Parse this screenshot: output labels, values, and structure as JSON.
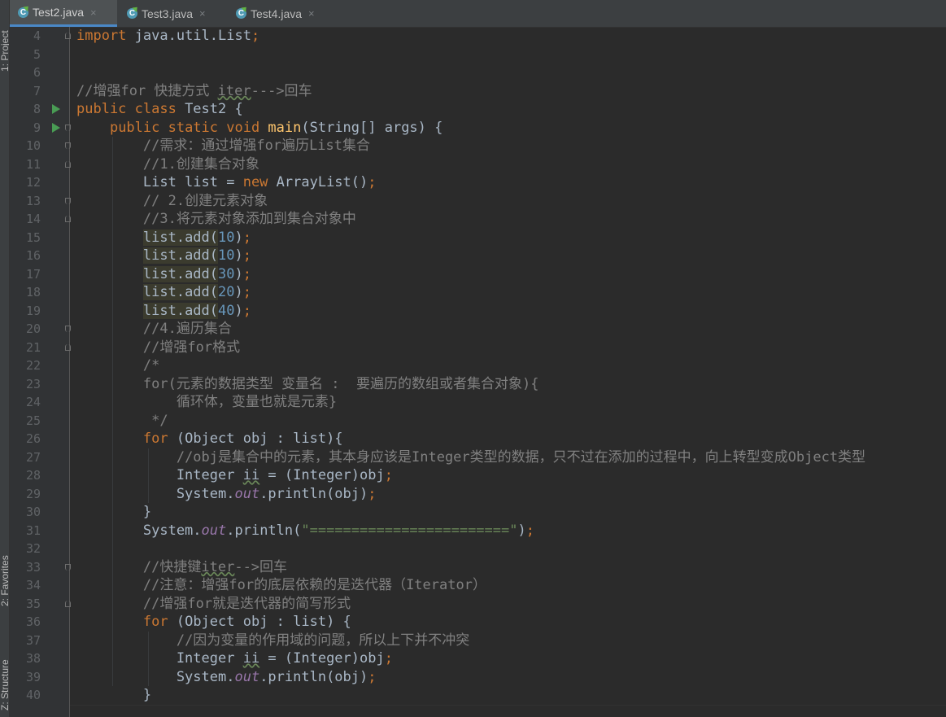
{
  "editor": {
    "tabs": [
      {
        "label": "Test2.java",
        "active": true
      },
      {
        "label": "Test3.java",
        "active": false
      },
      {
        "label": "Test4.java",
        "active": false
      }
    ],
    "tab_icon_letter": "C",
    "close_glyph": "×",
    "tool_windows": {
      "project": "1: Project",
      "favorites": "2: Favorites",
      "structure": "Z: Structure"
    },
    "lines": [
      {
        "n": "4",
        "fold": "close",
        "code": [
          {
            "t": "import",
            "c": "kw"
          },
          {
            "t": " java.util.List"
          },
          {
            "t": ";",
            "c": "kw"
          }
        ]
      },
      {
        "n": "5",
        "code": []
      },
      {
        "n": "6",
        "code": []
      },
      {
        "n": "7",
        "code": [
          {
            "t": "//增强for 快捷方式 ",
            "c": "cm"
          },
          {
            "t": "iter",
            "c": "cm warn"
          },
          {
            "t": "--->回车",
            "c": "cm"
          }
        ]
      },
      {
        "n": "8",
        "run": true,
        "code": [
          {
            "t": "public class ",
            "c": "kw"
          },
          {
            "t": "Test2 {"
          }
        ]
      },
      {
        "n": "9",
        "run": true,
        "fold": "open",
        "code": [
          {
            "t": "    "
          },
          {
            "t": "public static void ",
            "c": "kw"
          },
          {
            "t": "main",
            "c": "fn"
          },
          {
            "t": "(String[] args) {"
          }
        ]
      },
      {
        "n": "10",
        "fold": "open",
        "code": [
          {
            "t": "        "
          },
          {
            "t": "//需求：通过增强for遍历List集合",
            "c": "cm"
          }
        ]
      },
      {
        "n": "11",
        "fold": "close",
        "code": [
          {
            "t": "        "
          },
          {
            "t": "//1.创建集合对象",
            "c": "cm"
          }
        ]
      },
      {
        "n": "12",
        "code": [
          {
            "t": "        List list = "
          },
          {
            "t": "new ",
            "c": "kw"
          },
          {
            "t": "ArrayList()"
          },
          {
            "t": ";",
            "c": "kw"
          }
        ]
      },
      {
        "n": "13",
        "fold": "open",
        "code": [
          {
            "t": "        "
          },
          {
            "t": "// 2.创建元素对象",
            "c": "cm"
          }
        ]
      },
      {
        "n": "14",
        "fold": "close",
        "code": [
          {
            "t": "        "
          },
          {
            "t": "//3.将元素对象添加到集合对象中",
            "c": "cm"
          }
        ]
      },
      {
        "n": "15",
        "code": [
          {
            "t": "        "
          },
          {
            "t": "list.add(",
            "c": "hl"
          },
          {
            "t": "10",
            "c": "num"
          },
          {
            "t": ")"
          },
          {
            "t": ";",
            "c": "kw"
          }
        ]
      },
      {
        "n": "16",
        "code": [
          {
            "t": "        "
          },
          {
            "t": "list.add(",
            "c": "hl"
          },
          {
            "t": "10",
            "c": "num"
          },
          {
            "t": ")"
          },
          {
            "t": ";",
            "c": "kw"
          }
        ]
      },
      {
        "n": "17",
        "code": [
          {
            "t": "        "
          },
          {
            "t": "list.add(",
            "c": "hl"
          },
          {
            "t": "30",
            "c": "num"
          },
          {
            "t": ")"
          },
          {
            "t": ";",
            "c": "kw"
          }
        ]
      },
      {
        "n": "18",
        "code": [
          {
            "t": "        "
          },
          {
            "t": "list.add(",
            "c": "hl"
          },
          {
            "t": "20",
            "c": "num"
          },
          {
            "t": ")"
          },
          {
            "t": ";",
            "c": "kw"
          }
        ]
      },
      {
        "n": "19",
        "code": [
          {
            "t": "        "
          },
          {
            "t": "list.add(",
            "c": "hl"
          },
          {
            "t": "40",
            "c": "num"
          },
          {
            "t": ")"
          },
          {
            "t": ";",
            "c": "kw"
          }
        ]
      },
      {
        "n": "20",
        "fold": "open",
        "code": [
          {
            "t": "        "
          },
          {
            "t": "//4.遍历集合",
            "c": "cm"
          }
        ]
      },
      {
        "n": "21",
        "fold": "close",
        "code": [
          {
            "t": "        "
          },
          {
            "t": "//增强for格式",
            "c": "cm"
          }
        ]
      },
      {
        "n": "22",
        "code": [
          {
            "t": "        "
          },
          {
            "t": "/*",
            "c": "cm"
          }
        ]
      },
      {
        "n": "23",
        "code": [
          {
            "t": "        "
          },
          {
            "t": "for(元素的数据类型 变量名 :  要遍历的数组或者集合对象){",
            "c": "cm"
          }
        ]
      },
      {
        "n": "24",
        "code": [
          {
            "t": "            "
          },
          {
            "t": "循环体，变量也就是元素}",
            "c": "cm"
          }
        ]
      },
      {
        "n": "25",
        "code": [
          {
            "t": "         "
          },
          {
            "t": "*/",
            "c": "cm"
          }
        ]
      },
      {
        "n": "26",
        "code": [
          {
            "t": "        "
          },
          {
            "t": "for ",
            "c": "kw"
          },
          {
            "t": "(Object obj : list){"
          }
        ]
      },
      {
        "n": "27",
        "code": [
          {
            "t": "            "
          },
          {
            "t": "//obj是集合中的元素，其本身应该是Integer类型的数据，只不过在添加的过程中，向上转型变成Object类型",
            "c": "cm"
          }
        ]
      },
      {
        "n": "28",
        "code": [
          {
            "t": "            Integer "
          },
          {
            "t": "ii",
            "c": "warn"
          },
          {
            "t": " = (Integer)obj"
          },
          {
            "t": ";",
            "c": "kw"
          }
        ]
      },
      {
        "n": "29",
        "code": [
          {
            "t": "            System."
          },
          {
            "t": "out",
            "c": "st"
          },
          {
            "t": ".println(obj)"
          },
          {
            "t": ";",
            "c": "kw"
          }
        ]
      },
      {
        "n": "30",
        "code": [
          {
            "t": "        }"
          }
        ]
      },
      {
        "n": "31",
        "code": [
          {
            "t": "        System."
          },
          {
            "t": "out",
            "c": "st"
          },
          {
            "t": ".println("
          },
          {
            "t": "\"========================\"",
            "c": "str"
          },
          {
            "t": ")"
          },
          {
            "t": ";",
            "c": "kw"
          }
        ]
      },
      {
        "n": "32",
        "code": []
      },
      {
        "n": "33",
        "fold": "open",
        "code": [
          {
            "t": "        "
          },
          {
            "t": "//快捷键",
            "c": "cm"
          },
          {
            "t": "iter",
            "c": "cm warn"
          },
          {
            "t": "-->回车",
            "c": "cm"
          }
        ]
      },
      {
        "n": "34",
        "code": [
          {
            "t": "        "
          },
          {
            "t": "//注意：增强for的底层依赖的是迭代器（Iterator）",
            "c": "cm"
          }
        ]
      },
      {
        "n": "35",
        "fold": "close",
        "code": [
          {
            "t": "        "
          },
          {
            "t": "//增强for就是迭代器的简写形式",
            "c": "cm"
          }
        ]
      },
      {
        "n": "36",
        "code": [
          {
            "t": "        "
          },
          {
            "t": "for ",
            "c": "kw"
          },
          {
            "t": "(Object obj : list) {"
          }
        ]
      },
      {
        "n": "37",
        "code": [
          {
            "t": "            "
          },
          {
            "t": "//因为变量的作用域的问题，所以上下并不冲突",
            "c": "cm"
          }
        ]
      },
      {
        "n": "38",
        "code": [
          {
            "t": "            Integer "
          },
          {
            "t": "ii",
            "c": "warn"
          },
          {
            "t": " = (Integer)obj"
          },
          {
            "t": ";",
            "c": "kw"
          }
        ]
      },
      {
        "n": "39",
        "code": [
          {
            "t": "            System."
          },
          {
            "t": "out",
            "c": "st"
          },
          {
            "t": ".println(obj)"
          },
          {
            "t": ";",
            "c": "kw"
          }
        ]
      },
      {
        "n": "40",
        "code": [
          {
            "t": "        }"
          }
        ]
      }
    ]
  },
  "colors": {
    "background": "#2b2b2b",
    "gutter": "#313335",
    "keyword": "#cc7832",
    "comment": "#808080",
    "number": "#6897bb",
    "string": "#6a8759",
    "method": "#ffc66d",
    "static_field": "#9876aa",
    "text": "#a9b7c6",
    "run_icon": "#499c54",
    "tab_underline": "#4a88c7"
  }
}
